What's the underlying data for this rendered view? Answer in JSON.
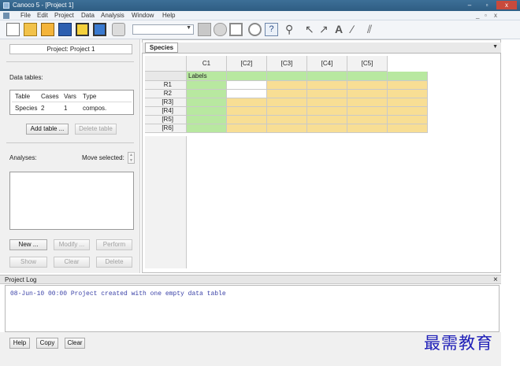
{
  "window": {
    "title": "Canoco 5 - [Project 1]",
    "buttons": {
      "minimize": "–",
      "restore": "▫",
      "close": "x"
    }
  },
  "menu": {
    "items": [
      "File",
      "Edit",
      "Project",
      "Data",
      "Analysis",
      "Window",
      "Help"
    ],
    "mdi_controls": [
      "_",
      "▫",
      "x"
    ]
  },
  "toolbar": {
    "icons": [
      "new-file-icon",
      "open-folder-icon",
      "open-file-icon",
      "save-icon",
      "wizard-icon",
      "chart-icon",
      "print-icon",
      "search-dropdown",
      "graph-icon",
      "refresh-icon",
      "table-icon",
      "target-icon",
      "help-icon",
      "select-icon",
      "pointer-icon",
      "add-point-icon",
      "add-text-icon",
      "add-line-icon",
      "edit-lines-icon"
    ],
    "combo_value": ""
  },
  "left": {
    "project_label": "Project: Project 1",
    "data_tables_label": "Data tables:",
    "table_headers": [
      "Table",
      "Cases",
      "Vars",
      "Type"
    ],
    "table_rows": [
      [
        "Species",
        "2",
        "1",
        "compos."
      ]
    ],
    "add_table": "Add table ...",
    "delete_table": "Delete table",
    "analyses_label": "Analyses:",
    "move_selected_label": "Move selected:",
    "new_btn": "New ...",
    "modify_btn": "Modify ...",
    "perform_btn": "Perform",
    "show_btn": "Show",
    "clear_btn": "Clear",
    "delete_btn": "Delete"
  },
  "species": {
    "tab": "Species",
    "columns": [
      "C1",
      "[C2]",
      "[C3]",
      "[C4]",
      "[C5]"
    ],
    "row_labels": [
      "R1",
      "R2",
      "[R3]",
      "[R4]",
      "[R5]",
      "[R6]"
    ],
    "labels_header": "Labels",
    "colors": {
      "green": "#b8e8a0",
      "yellow": "#f8de94"
    }
  },
  "log": {
    "title": "Project Log",
    "close": "×",
    "text": "08-Jun-10 00:00 Project created with one empty data table",
    "help_btn": "Help",
    "copy_btn": "Copy",
    "clear_btn": "Clear"
  },
  "watermark": "最需教育"
}
